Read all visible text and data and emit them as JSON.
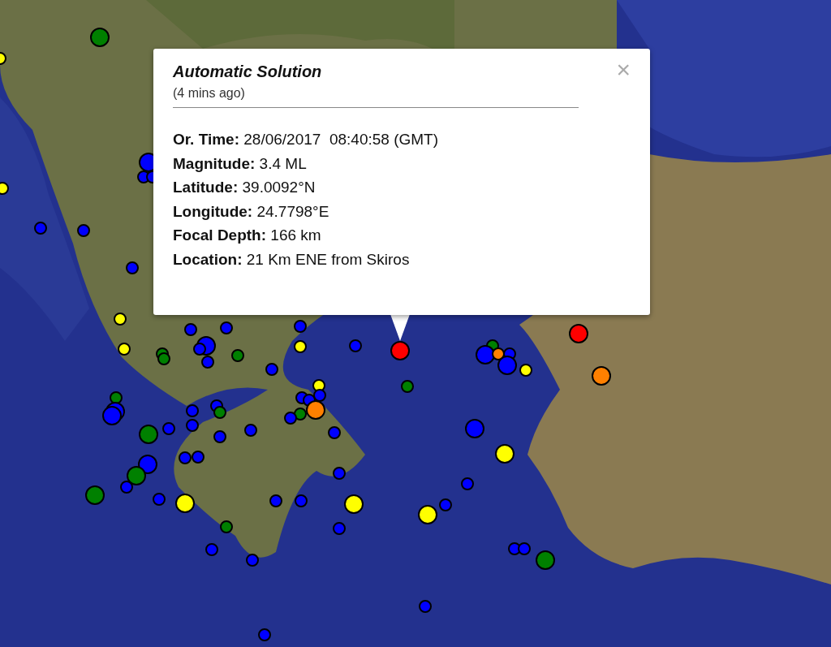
{
  "popup": {
    "title": "Automatic Solution",
    "time_ago": "(4 mins ago)",
    "close": "×",
    "fields": [
      {
        "label": "Or. Time:",
        "value": "28/06/2017  08:40:58 (GMT)"
      },
      {
        "label": "Magnitude:",
        "value": "3.4 ML"
      },
      {
        "label": "Latitude:",
        "value": "39.0092°N"
      },
      {
        "label": "Longitude:",
        "value": "24.7798°E"
      },
      {
        "label": "Focal Depth:",
        "value": "166 km"
      },
      {
        "label": "Location:",
        "value": "21 Km ENE from Skiros"
      }
    ]
  },
  "markers": [
    {
      "kind": "large",
      "color": "#008000"
    },
    {
      "kind": "small",
      "color": "#ffff00"
    },
    {
      "kind": "small",
      "color": "#ffff00"
    },
    {
      "kind": "large",
      "color": "#0000ff"
    },
    {
      "kind": "small",
      "color": "#0000ff"
    },
    {
      "kind": "small",
      "color": "#0000ff"
    },
    {
      "kind": "small",
      "color": "#0000ff"
    },
    {
      "kind": "small",
      "color": "#0000ff"
    },
    {
      "kind": "small",
      "color": "#0000ff"
    },
    {
      "kind": "small",
      "color": "#ffff00"
    },
    {
      "kind": "small",
      "color": "#ffff00"
    },
    {
      "kind": "small",
      "color": "#0000ff"
    },
    {
      "kind": "small",
      "color": "#0000ff"
    },
    {
      "kind": "large",
      "color": "#0000ff"
    },
    {
      "kind": "small",
      "color": "#0000ff"
    },
    {
      "kind": "small",
      "color": "#008000"
    },
    {
      "kind": "small",
      "color": "#008000"
    },
    {
      "kind": "small",
      "color": "#008000"
    },
    {
      "kind": "small",
      "color": "#0000ff"
    },
    {
      "kind": "small",
      "color": "#0000ff"
    },
    {
      "kind": "small",
      "color": "#ffff00"
    },
    {
      "kind": "small",
      "color": "#0000ff"
    },
    {
      "kind": "large",
      "color": "#ff0000"
    },
    {
      "kind": "small",
      "color": "#008000"
    },
    {
      "kind": "small",
      "color": "#0000ff"
    },
    {
      "kind": "small",
      "color": "#ffff00"
    },
    {
      "kind": "small",
      "color": "#0000ff"
    },
    {
      "kind": "small",
      "color": "#0000ff"
    },
    {
      "kind": "small",
      "color": "#0000ff"
    },
    {
      "kind": "large",
      "color": "#ff8000"
    },
    {
      "kind": "small",
      "color": "#008000"
    },
    {
      "kind": "small",
      "color": "#0000ff"
    },
    {
      "kind": "small",
      "color": "#008000"
    },
    {
      "kind": "large",
      "color": "#0000ff"
    },
    {
      "kind": "large",
      "color": "#0000ff"
    },
    {
      "kind": "small",
      "color": "#0000ff"
    },
    {
      "kind": "small",
      "color": "#0000ff"
    },
    {
      "kind": "small",
      "color": "#008000"
    },
    {
      "kind": "small",
      "color": "#0000ff"
    },
    {
      "kind": "small",
      "color": "#0000ff"
    },
    {
      "kind": "large",
      "color": "#008000"
    },
    {
      "kind": "small",
      "color": "#0000ff"
    },
    {
      "kind": "small",
      "color": "#0000ff"
    },
    {
      "kind": "small",
      "color": "#0000ff"
    },
    {
      "kind": "small",
      "color": "#0000ff"
    },
    {
      "kind": "small",
      "color": "#0000ff"
    },
    {
      "kind": "large",
      "color": "#0000ff"
    },
    {
      "kind": "large",
      "color": "#008000"
    },
    {
      "kind": "small",
      "color": "#0000ff"
    },
    {
      "kind": "large",
      "color": "#008000"
    },
    {
      "kind": "small",
      "color": "#0000ff"
    },
    {
      "kind": "large",
      "color": "#ffff00"
    },
    {
      "kind": "small",
      "color": "#0000ff"
    },
    {
      "kind": "small",
      "color": "#0000ff"
    },
    {
      "kind": "large",
      "color": "#ffff00"
    },
    {
      "kind": "small",
      "color": "#0000ff"
    },
    {
      "kind": "large",
      "color": "#ffff00"
    },
    {
      "kind": "small",
      "color": "#0000ff"
    },
    {
      "kind": "small",
      "color": "#008000"
    },
    {
      "kind": "small",
      "color": "#0000ff"
    },
    {
      "kind": "small",
      "color": "#0000ff"
    },
    {
      "kind": "small",
      "color": "#0000ff"
    },
    {
      "kind": "small",
      "color": "#0000ff"
    },
    {
      "kind": "small",
      "color": "#0000ff"
    },
    {
      "kind": "small",
      "color": "#008000"
    },
    {
      "kind": "large",
      "color": "#0000ff"
    },
    {
      "kind": "small",
      "color": "#ff8000"
    },
    {
      "kind": "small",
      "color": "#0000ff"
    },
    {
      "kind": "large",
      "color": "#0000ff"
    },
    {
      "kind": "small",
      "color": "#ffff00"
    },
    {
      "kind": "large",
      "color": "#ff0000"
    },
    {
      "kind": "large",
      "color": "#ff8000"
    },
    {
      "kind": "large",
      "color": "#0000ff"
    },
    {
      "kind": "large",
      "color": "#ffff00"
    },
    {
      "kind": "small",
      "color": "#0000ff"
    },
    {
      "kind": "small",
      "color": "#0000ff"
    },
    {
      "kind": "small",
      "color": "#0000ff"
    },
    {
      "kind": "large",
      "color": "#008000"
    }
  ]
}
